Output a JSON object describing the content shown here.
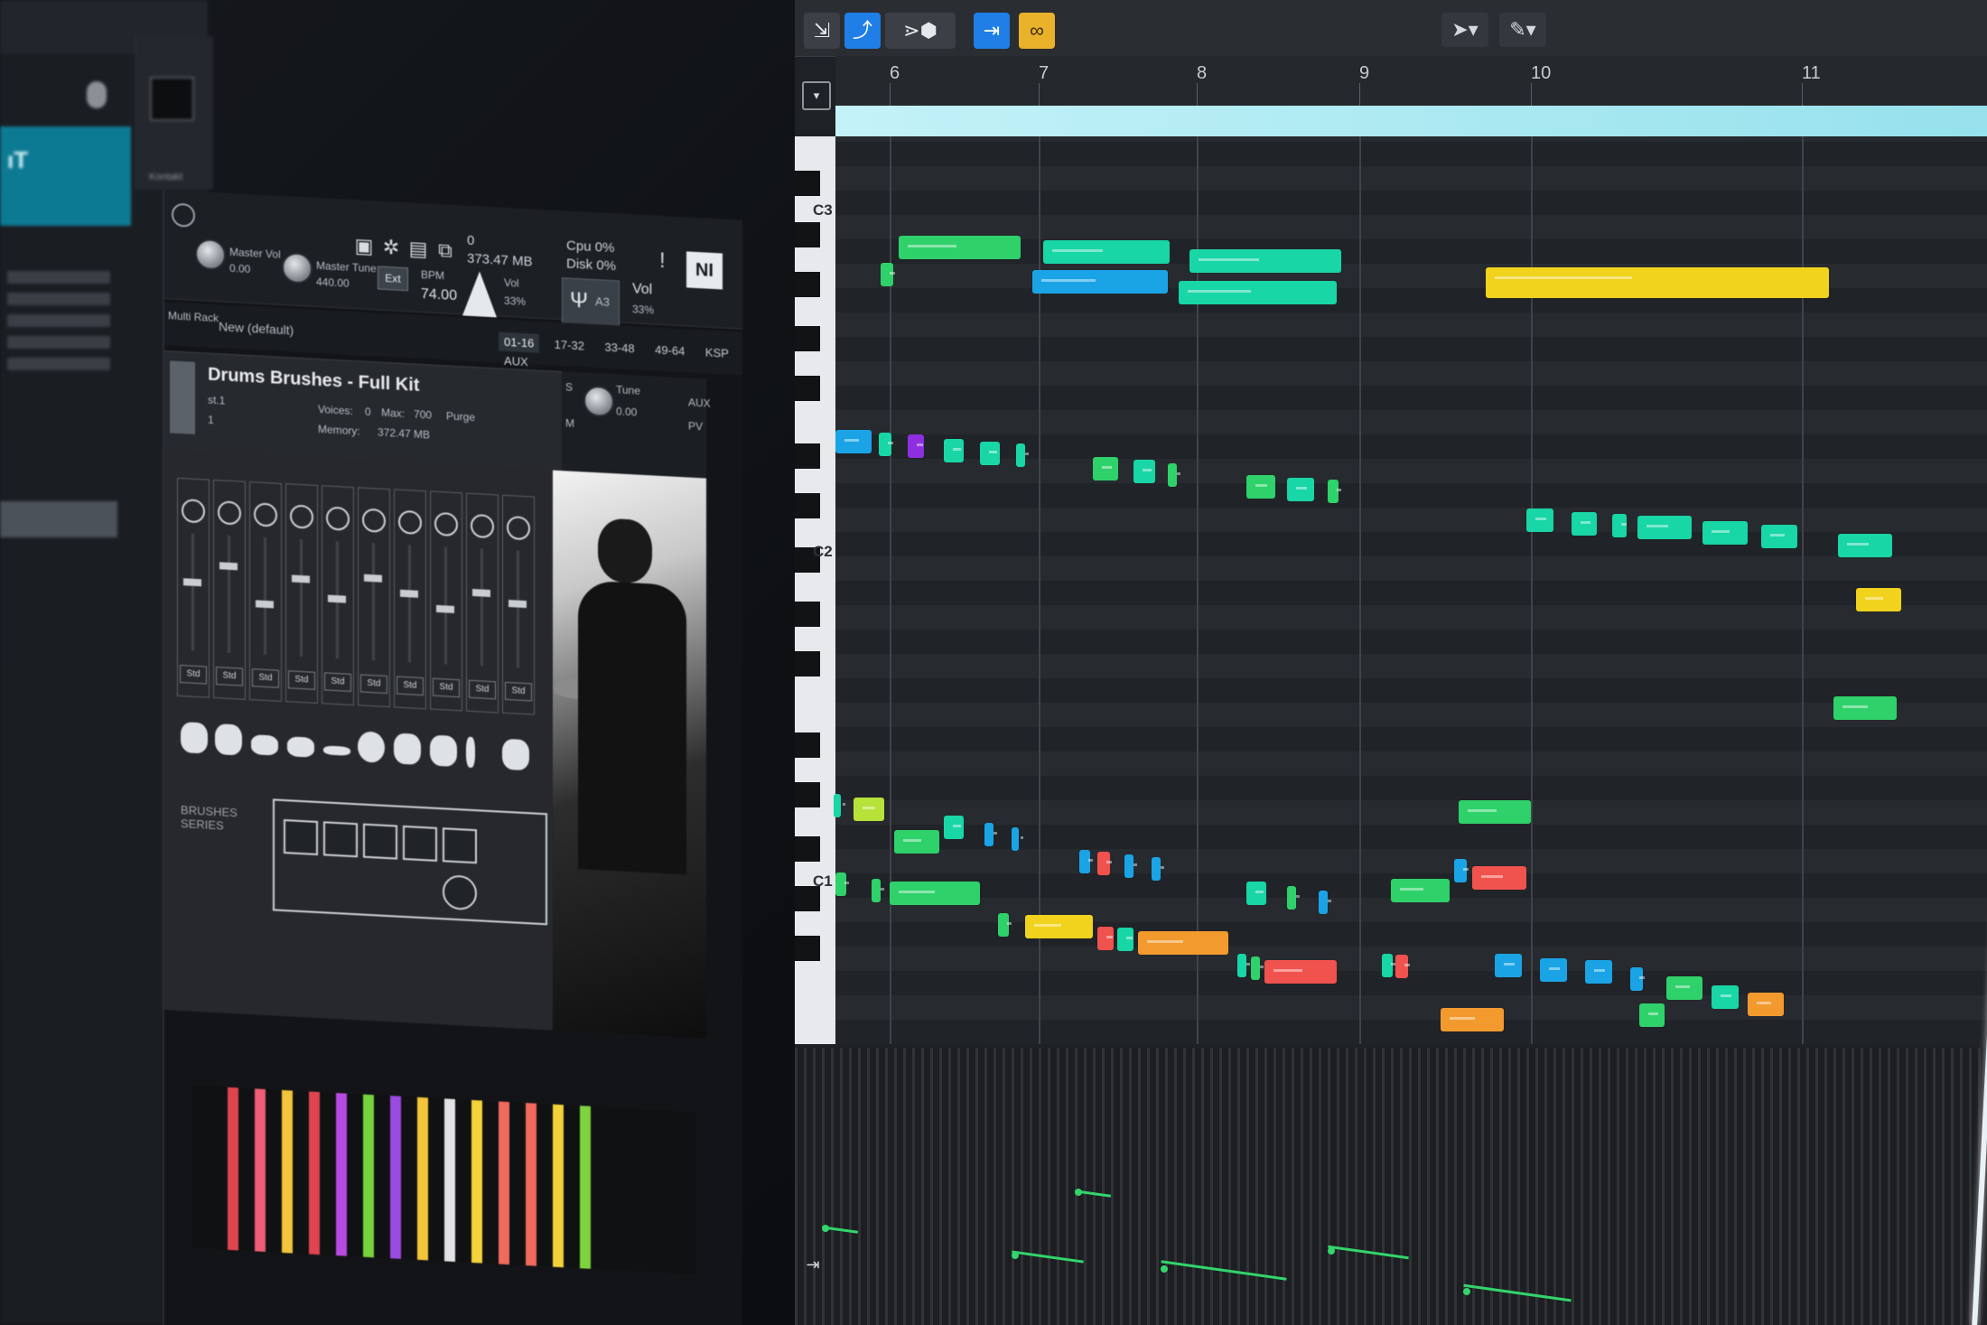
{
  "left_browser": {
    "band_label": "ıT",
    "thumb_label": "Kontakt"
  },
  "kontakt": {
    "stats": {
      "midi": "0",
      "memory": "373.47 MB",
      "cpu_label": "Cpu",
      "cpu_value": "0%",
      "disk_label": "Disk",
      "disk_value": "0%",
      "warning": "!"
    },
    "logo": "NI",
    "master_vol": {
      "label": "Master Vol",
      "value": "0.00"
    },
    "master_tune": {
      "label": "Master Tune",
      "value": "440.00"
    },
    "ext_button": "Ext",
    "bpm": {
      "label": "BPM",
      "value": "74.00"
    },
    "metronome": {
      "label": "Vol",
      "value": "33%"
    },
    "tuner": {
      "note": "A3",
      "label": "Vol",
      "value": "33%"
    },
    "rack": {
      "label": "Multi Rack",
      "preset": "New (default)"
    },
    "tabs": [
      "01-16",
      "17-32",
      "33-48",
      "49-64",
      "KSP",
      "AUX"
    ],
    "instrument": {
      "title": "Drums Brushes - Full Kit",
      "output": "st.1",
      "midi_ch": "1",
      "voices_label": "Voices:",
      "voices_value": "0",
      "max_label": "Max:",
      "max_value": "700",
      "purge": "Purge",
      "memory_label": "Memory:",
      "memory_value": "372.47 MB",
      "tune_label": "Tune",
      "tune_value": "0.00",
      "solo": "S",
      "mute": "M",
      "aux": "AUX",
      "pv": "PV"
    },
    "channel_outputs": [
      "Std",
      "Std",
      "Std",
      "Std",
      "Std",
      "Std",
      "Std",
      "Std",
      "Std",
      "Std"
    ],
    "brand": "BRUSHES SERIES"
  },
  "daw": {
    "toolbar": [
      {
        "icon": "collapse-icon",
        "variant": "gray"
      },
      {
        "icon": "automation-icon",
        "variant": "blue"
      },
      {
        "icon": "midi-filter-icon",
        "variant": "gray"
      },
      {
        "icon": "catch-playhead-icon",
        "variant": "blue"
      },
      {
        "icon": "link-icon",
        "variant": "gold"
      }
    ],
    "tools": [
      {
        "icon": "pointer-tool-icon"
      },
      {
        "icon": "pencil-tool-icon"
      }
    ],
    "bars": [
      "6",
      "7",
      "8",
      "9",
      "10",
      "11"
    ],
    "octaves": [
      "C3",
      "C2",
      "C1"
    ],
    "colors": {
      "green": "#2fd16a",
      "teal": "#18d6a6",
      "blue": "#1aa4e6",
      "yellow": "#f1d21c",
      "orange": "#f29a2e",
      "red": "#f0524e",
      "purple": "#8d2fe0",
      "lime": "#b7e23a"
    }
  }
}
